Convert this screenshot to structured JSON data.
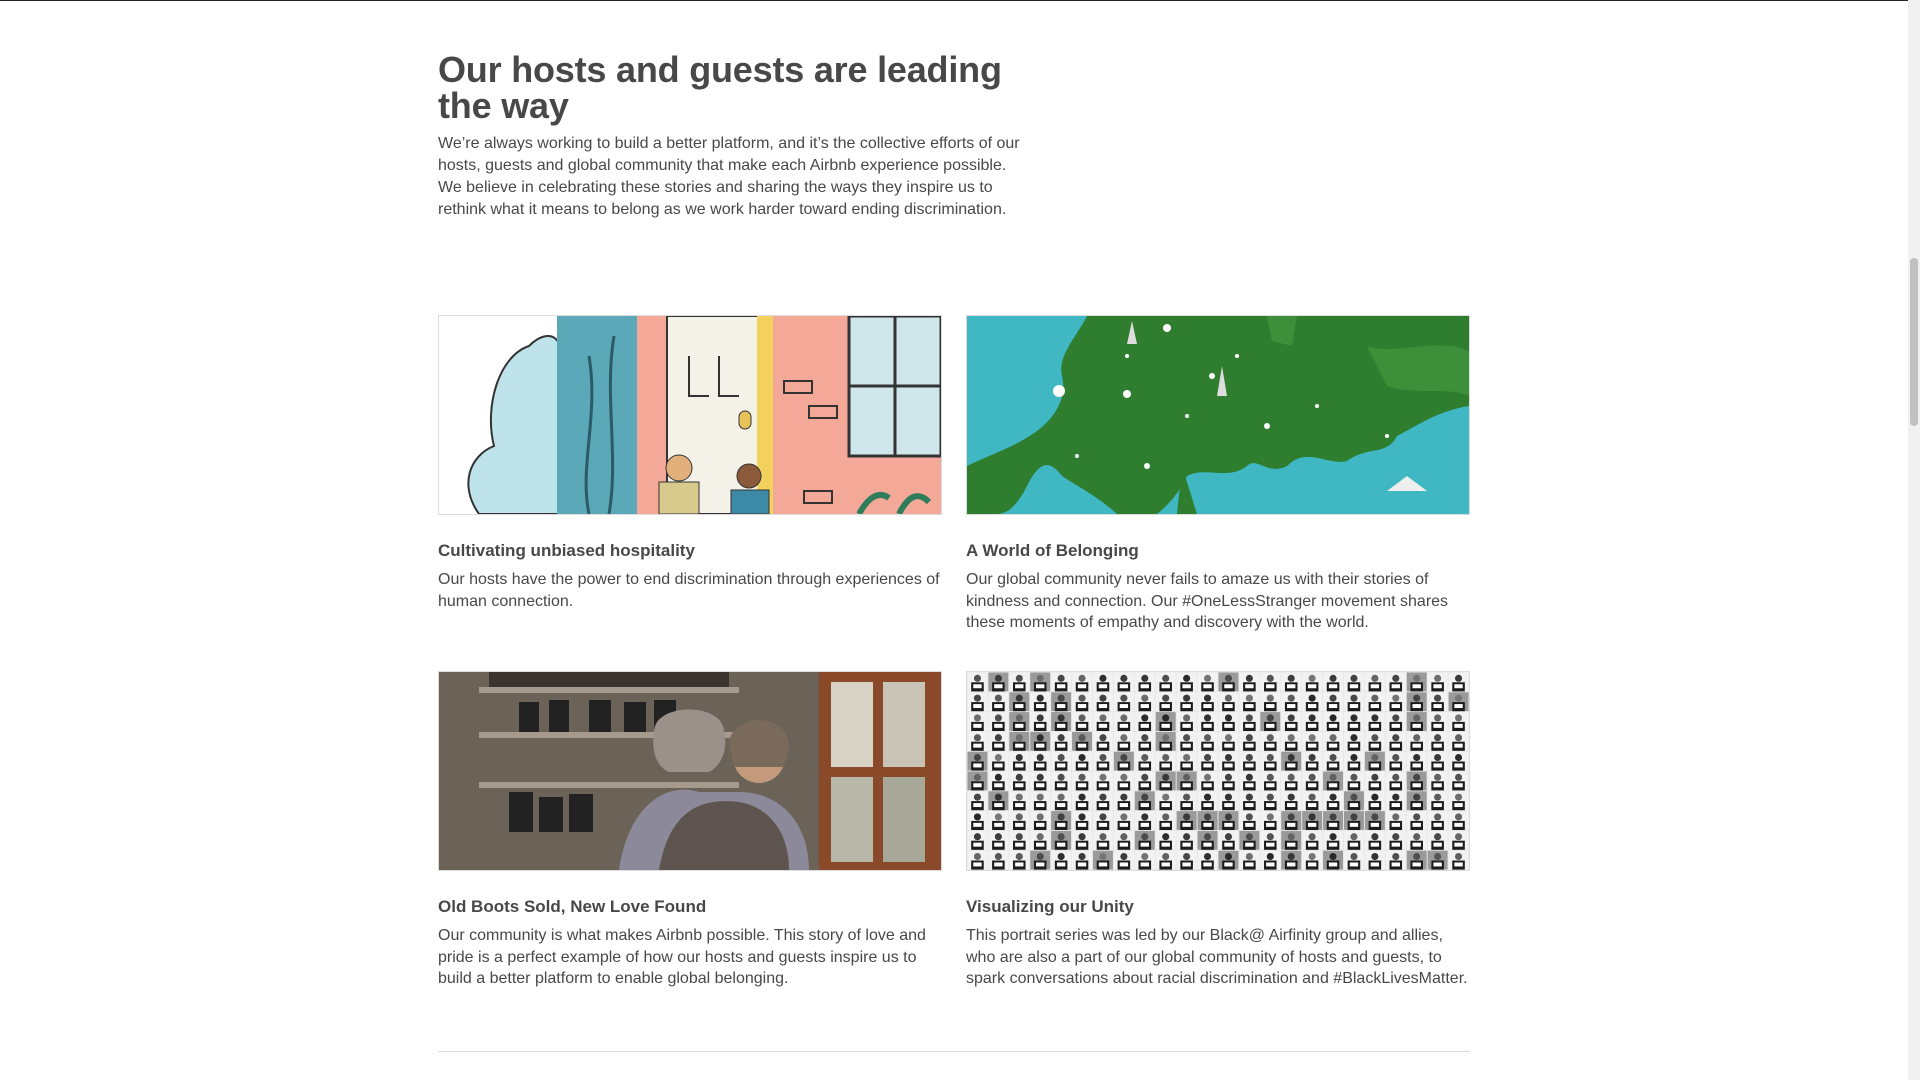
{
  "intro": {
    "title": "Our hosts and guests are leading the way",
    "body": "We’re always working to build a better platform, and it’s the collective efforts of our hosts, guests and global community that make each Airbnb experience possible. We believe in celebrating these stories and sharing the ways they inspire us to rethink what it means to belong as we work harder toward ending discrimination."
  },
  "cards": [
    {
      "title": "Cultivating unbiased hospitality",
      "body": "Our hosts have the power to end discrimination through experiences of human connection."
    },
    {
      "title": "A World of Belonging",
      "body": "Our global community never fails to amaze us with their stories of kindness and connection. Our #OneLessStranger movement shares these moments of empathy and discovery with the world."
    },
    {
      "title": "Old Boots Sold, New Love Found",
      "body": "Our community is what makes Airbnb possible. This story of love and pride is a perfect example of how our hosts and guests inspire us to build a better platform to enable global belonging."
    },
    {
      "title": "Visualizing our Unity",
      "body": "This portrait series was led by our Black@ Airfinity group and allies, who are also a part of our global community of hosts and guests, to spark conversations about racial discrimination and #BlackLivesMatter."
    }
  ],
  "colors": {
    "text": "#484848",
    "map_sea": "#3fb8c4",
    "map_land": "#2f7d2f",
    "illustration_pink": "#f4a898",
    "illustration_teal": "#5aa8b8"
  }
}
